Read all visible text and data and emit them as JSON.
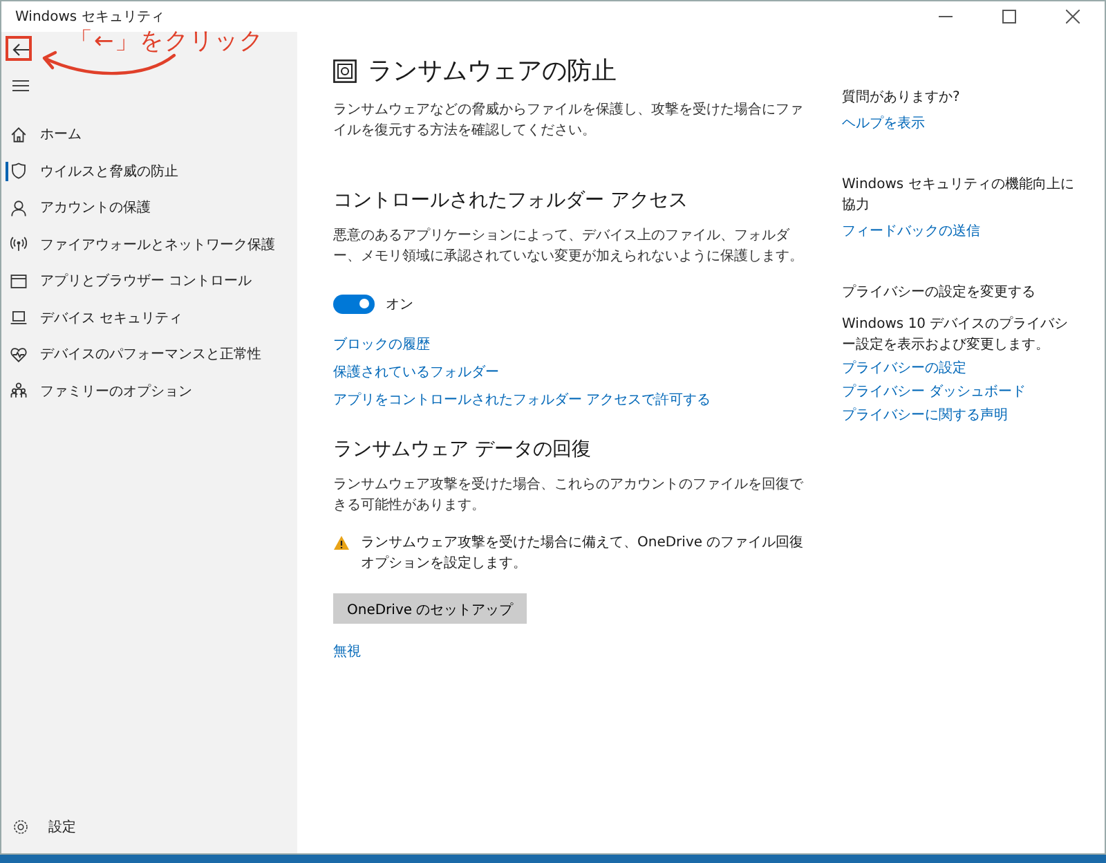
{
  "window": {
    "title": "Windows セキュリティ"
  },
  "annotation": {
    "text": "「←」をクリック"
  },
  "sidebar": {
    "items": [
      {
        "label": "ホーム",
        "selected": false
      },
      {
        "label": "ウイルスと脅威の防止",
        "selected": true
      },
      {
        "label": "アカウントの保護",
        "selected": false
      },
      {
        "label": "ファイアウォールとネットワーク保護",
        "selected": false
      },
      {
        "label": "アプリとブラウザー コントロール",
        "selected": false
      },
      {
        "label": "デバイス セキュリティ",
        "selected": false
      },
      {
        "label": "デバイスのパフォーマンスと正常性",
        "selected": false
      },
      {
        "label": "ファミリーのオプション",
        "selected": false
      }
    ],
    "settings": "設定"
  },
  "page": {
    "title": "ランサムウェアの防止",
    "description": "ランサムウェアなどの脅威からファイルを保護し、攻撃を受けた場合にファイルを復元する方法を確認してください。",
    "folder_access": {
      "heading": "コントロールされたフォルダー アクセス",
      "description": "悪意のあるアプリケーションによって、デバイス上のファイル、フォルダー、メモリ領域に承認されていない変更が加えられないように保護します。",
      "toggle": {
        "on": true,
        "label": "オン"
      },
      "links": [
        "ブロックの履歴",
        "保護されているフォルダー",
        "アプリをコントロールされたフォルダー アクセスで許可する"
      ]
    },
    "recovery": {
      "heading": "ランサムウェア データの回復",
      "description": "ランサムウェア攻撃を受けた場合、これらのアカウントのファイルを回復できる可能性があります。",
      "warning": "ランサムウェア攻撃を受けた場合に備えて、OneDrive のファイル回復オプションを設定します。",
      "button": "OneDrive のセットアップ",
      "dismiss": "無視"
    }
  },
  "side_panel": [
    {
      "heading": "質問がありますか?",
      "links": [
        "ヘルプを表示"
      ]
    },
    {
      "heading": "Windows セキュリティの機能向上に協力",
      "links": [
        "フィードバックの送信"
      ]
    },
    {
      "heading": "プライバシーの設定を変更する",
      "text": "Windows 10 デバイスのプライバシー設定を表示および変更します。",
      "links": [
        "プライバシーの設定",
        "プライバシー ダッシュボード",
        "プライバシーに関する声明"
      ]
    }
  ]
}
